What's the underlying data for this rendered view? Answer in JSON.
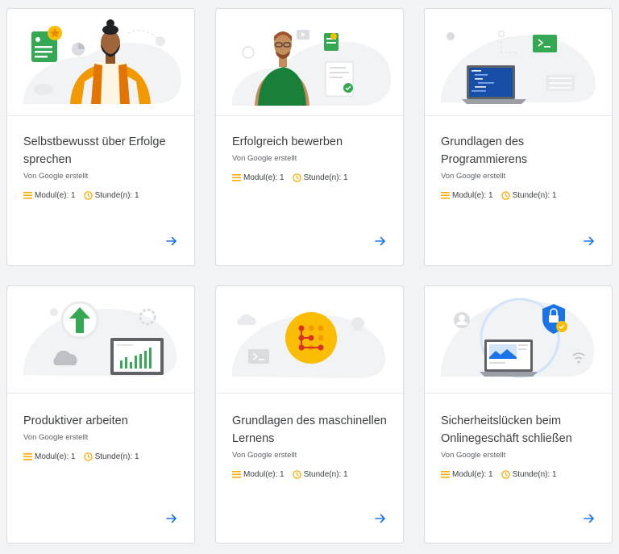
{
  "colors": {
    "accent_blue": "#1a73e8",
    "meta_yellow": "#f9ab00"
  },
  "cards": [
    {
      "title": "Selbstbewusst über Erfolge sprechen",
      "author": "Von Google erstellt",
      "modules": "Modul(e): 1",
      "hours": "Stunde(n): 1"
    },
    {
      "title": "Erfolgreich bewerben",
      "author": "Von Google erstellt",
      "modules": "Modul(e): 1",
      "hours": "Stunde(n): 1"
    },
    {
      "title": "Grundlagen des Programmierens",
      "author": "Von Google erstellt",
      "modules": "Modul(e): 1",
      "hours": "Stunde(n): 1"
    },
    {
      "title": "Produktiver arbeiten",
      "author": "Von Google erstellt",
      "modules": "Modul(e): 1",
      "hours": "Stunde(n): 1"
    },
    {
      "title": "Grundlagen des maschinellen Lernens",
      "author": "Von Google erstellt",
      "modules": "Modul(e): 1",
      "hours": "Stunde(n): 1"
    },
    {
      "title": "Sicherheitslücken beim Onlinegeschäft schließen",
      "author": "Von Google erstellt",
      "modules": "Modul(e): 1",
      "hours": "Stunde(n): 1"
    }
  ]
}
